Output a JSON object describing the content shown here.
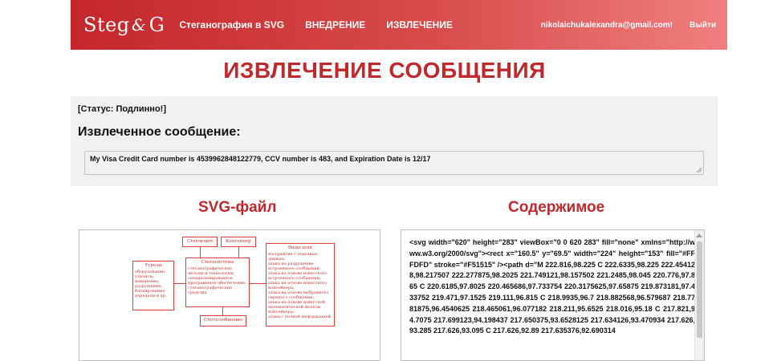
{
  "header": {
    "logo_left": "Steg",
    "logo_right": "G",
    "nav": [
      "Стеганография в SVG",
      "ВНЕДРЕНИЕ",
      "ИЗВЛЕЧЕНИЕ"
    ],
    "email": "nikolaichukalexandra@gmail.com!",
    "logout": "Выйти"
  },
  "page": {
    "title": "ИЗВЛЕЧЕНИЕ СООБЩЕНИЯ"
  },
  "result": {
    "status": "[Статус: Подлинно!]",
    "extracted_label": "Извлеченное сообщение:",
    "message": "My Visa Credit Card number is 4539962848122779, CCV number is 483, and Expiration Date is 12/17"
  },
  "sections": {
    "svg_file": "SVG-файл",
    "content": "Содержимое"
  },
  "diagram": {
    "steg_container": "Стегоключ",
    "container": "Контейнер",
    "stegosystem": "Стегосистема",
    "stego_items": [
      "стеганографические методы и технологии;",
      "специализированное программное обеспечение;",
      "стеганографические средства"
    ],
    "threats": "Угрозы",
    "threat_items": [
      "оборудование;",
      "утилиты;",
      "изменение;",
      "разрушение;",
      "блокирование передачи и др."
    ],
    "attacks": "Виды атак",
    "attack_items": [
      "восприятие с помощью данных;",
      "атака на разрушение встроенного сообщения;",
      "атака на основе известного встроенного сообщения;",
      "атака на основе известного контейнера;",
      "атака на основе выбранного скрытого сообщения;",
      "атака на основе известной математической модели контейнера;",
      "атака с полной информацией."
    ],
    "stego_message": "Стегосообщение"
  },
  "svg_content": "<svg width=\"620\" height=\"283\" viewBox=\"0 0 620 283\" fill=\"none\" xmlns=\"http://www.w3.org/2000/svg\"><rect x=\"160.5\" y=\"69.5\" width=\"224\" height=\"153\" fill=\"#FFFDFD\" stroke=\"#F51515\" /><path d=\"M 222.816,98.225 C 222.6335,98.225 222.454128,98.217507 222.277875,98.2025 221.749121,98.157502 221.2485,98.045 220.776,97.865 C 220.6185,97.8025 220.465686,97.733754 220.3175625,97.65875 219.873181,97.433752 219.471,97.1525 219.111,96.815 C 218.9935,96.7 218.882568,96.579687 218.7781875,96.4540625 218.465061,96.077182 218.211,95.6525 218.016,95.18 C 217.821,94.7075 217.699123,94.198437 217.650375,93.6528125 217.634126,93.470934 217.626,93.285 217.626,93.095 C 217.626,92.89 217.635376,92.690314"
}
